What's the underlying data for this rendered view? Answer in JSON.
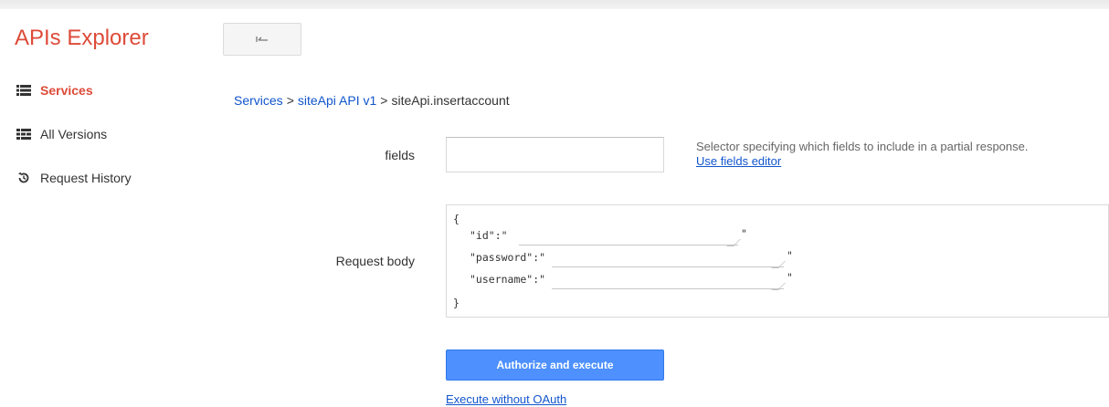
{
  "app": {
    "title": "APIs Explorer",
    "accent_color": "#dd4b39",
    "back_icon": "back-arrow-icon"
  },
  "sidebar": {
    "items": [
      {
        "label": "Services",
        "icon": "list-icon",
        "active": true
      },
      {
        "label": "All Versions",
        "icon": "versions-icon",
        "active": false
      },
      {
        "label": "Request History",
        "icon": "history-icon",
        "active": false
      }
    ]
  },
  "breadcrumb": {
    "services": "Services",
    "sep1": ">",
    "api": "siteApi API v1",
    "sep2": ">",
    "method": "siteApi.insertaccount"
  },
  "form": {
    "fields_label": "fields",
    "fields_value": "",
    "fields_help": "Selector specifying which fields to include in a partial response.",
    "fields_editor_link": "Use fields editor",
    "request_body_label": "Request body",
    "body": {
      "open_brace": "{",
      "close_brace": "}",
      "id_key": "\"id\":\"",
      "id_value": "",
      "password_key": "\"password\":\"",
      "password_value": "",
      "username_key": "\"username\":\"",
      "username_value": "",
      "quote": "\""
    }
  },
  "actions": {
    "execute_label": "Authorize and execute",
    "execute_color": "#4d90fe",
    "no_oauth_label": "Execute without OAuth",
    "link_color": "#1155cc"
  }
}
